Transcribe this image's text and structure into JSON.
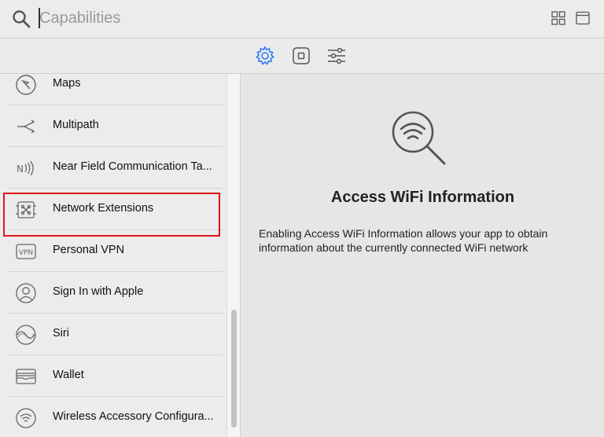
{
  "search": {
    "placeholder": "Capabilities",
    "value": ""
  },
  "tabs": [
    {
      "icon": "gear-icon",
      "active": true
    },
    {
      "icon": "square-icon",
      "active": false
    },
    {
      "icon": "sliders-icon",
      "active": false
    }
  ],
  "sidebar": {
    "items": [
      {
        "label": "Maps",
        "icon": "maps-icon"
      },
      {
        "label": "Multipath",
        "icon": "multipath-icon"
      },
      {
        "label": "Near Field Communication Ta...",
        "icon": "nfc-icon"
      },
      {
        "label": "Network Extensions",
        "icon": "network-extensions-icon"
      },
      {
        "label": "Personal VPN",
        "icon": "vpn-icon",
        "icon_text": "VPN"
      },
      {
        "label": "Sign In with Apple",
        "icon": "person-icon",
        "highlighted": true
      },
      {
        "label": "Siri",
        "icon": "siri-icon"
      },
      {
        "label": "Wallet",
        "icon": "wallet-icon"
      },
      {
        "label": "Wireless Accessory Configura...",
        "icon": "wifi-icon"
      }
    ]
  },
  "detail": {
    "icon": "wifi-search-icon",
    "title": "Access WiFi Information",
    "description": "Enabling Access WiFi Information allows your app to obtain information about the currently connected WiFi network"
  },
  "colors": {
    "accent": "#2f7df6",
    "highlight": "#e0141a"
  }
}
